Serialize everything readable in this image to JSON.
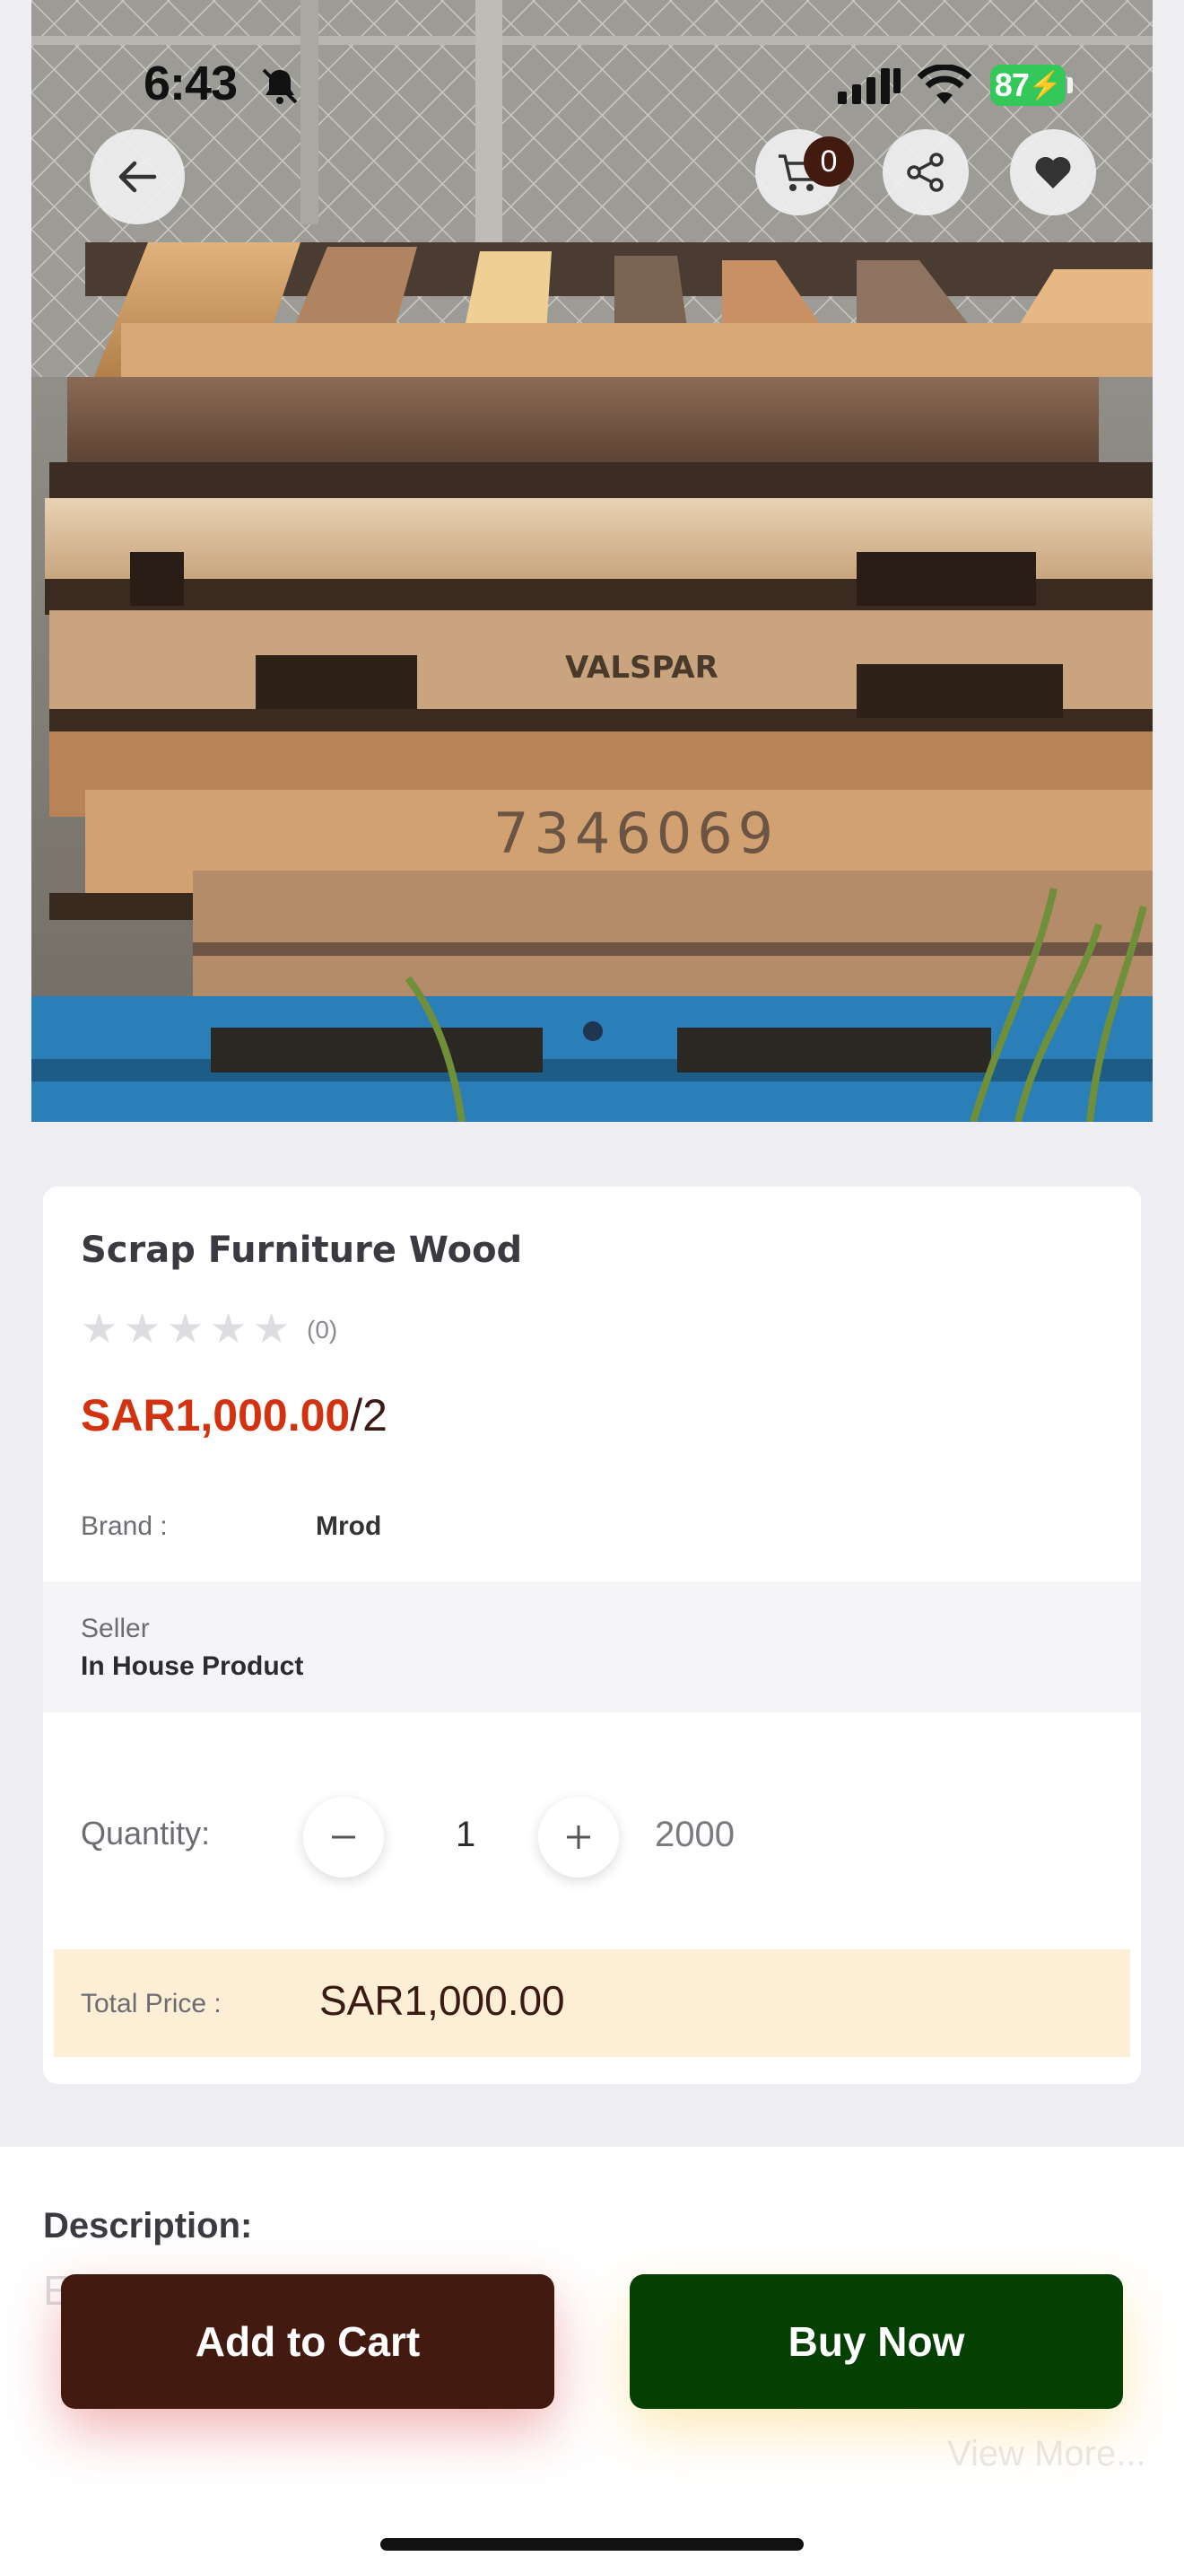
{
  "status_bar": {
    "time": "6:43",
    "battery": "87",
    "icons": [
      "bell-slash-icon",
      "signal-icon",
      "wifi-icon",
      "battery-charging-icon"
    ]
  },
  "header": {
    "cart_count": "0",
    "icons": [
      "arrow-left-icon",
      "cart-icon",
      "share-icon",
      "heart-icon"
    ]
  },
  "gallery": {
    "slide_count": 1,
    "active_slide": 1,
    "image_text": [
      "VALSPAR",
      "7346069"
    ]
  },
  "product": {
    "title": "Scrap Furniture Wood",
    "rating": 0,
    "review_count": "(0)",
    "price": "SAR1,000.00",
    "unit": "/2",
    "brand_label": "Brand :",
    "brand_value": "Mrod",
    "seller_label": "Seller",
    "seller_value": "In House Product",
    "quantity_label": "Quantity:",
    "quantity_value": "1",
    "stock": "2000",
    "total_label": "Total Price :",
    "total_value": "SAR1,000.00"
  },
  "description": {
    "title": "Description:",
    "text_partial": "E                    n f                   ll",
    "view_more": "View More..."
  },
  "actions": {
    "add_to_cart": "Add to Cart",
    "buy_now": "Buy Now"
  },
  "colors": {
    "price": "#d2320f",
    "add_to_cart_bg": "#431a10",
    "buy_now_bg": "#054003",
    "total_box_bg": "#fdefd6",
    "battery": "#34c759"
  }
}
